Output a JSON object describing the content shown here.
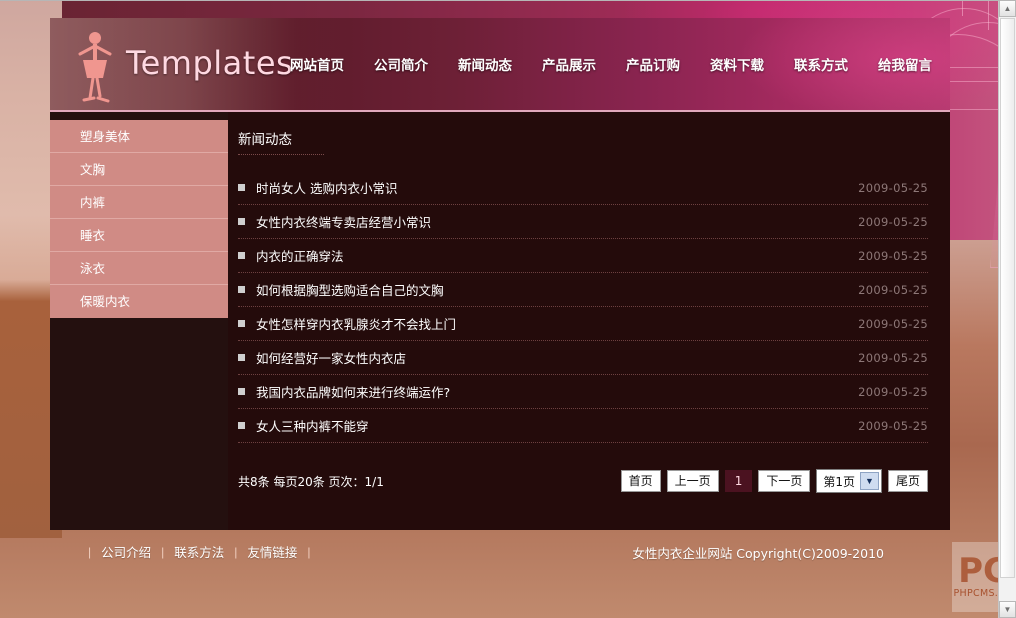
{
  "site": {
    "logo_text": "Templates",
    "logo_icon": "woman-figure-logo"
  },
  "nav": {
    "items": [
      {
        "label": "网站首页"
      },
      {
        "label": "公司简介"
      },
      {
        "label": "新闻动态"
      },
      {
        "label": "产品展示"
      },
      {
        "label": "产品订购"
      },
      {
        "label": "资料下载"
      },
      {
        "label": "联系方式"
      },
      {
        "label": "给我留言"
      }
    ]
  },
  "sidebar": {
    "items": [
      {
        "label": "塑身美体"
      },
      {
        "label": "文胸"
      },
      {
        "label": "内裤"
      },
      {
        "label": "睡衣"
      },
      {
        "label": "泳衣"
      },
      {
        "label": "保暖内衣"
      }
    ]
  },
  "content": {
    "page_title": "新闻动态",
    "news": [
      {
        "title": "时尚女人 选购内衣小常识",
        "date": "2009-05-25"
      },
      {
        "title": "女性内衣终端专卖店经营小常识",
        "date": "2009-05-25"
      },
      {
        "title": "内衣的正确穿法",
        "date": "2009-05-25"
      },
      {
        "title": "如何根据胸型选购适合自己的文胸",
        "date": "2009-05-25"
      },
      {
        "title": "女性怎样穿内衣乳腺炎才不会找上门",
        "date": "2009-05-25"
      },
      {
        "title": "如何经营好一家女性内衣店",
        "date": "2009-05-25"
      },
      {
        "title": "我国内衣品牌如何来进行终端运作?",
        "date": "2009-05-25"
      },
      {
        "title": "女人三种内裤不能穿",
        "date": "2009-05-25"
      }
    ]
  },
  "pager": {
    "info": "共8条 每页20条 页次：1/1",
    "first_label": "首页",
    "prev_label": "上一页",
    "current_page": "1",
    "next_label": "下一页",
    "select_label": "第1页",
    "select_arrow": "▼",
    "last_label": "尾页"
  },
  "footer": {
    "links": [
      {
        "label": "公司介绍"
      },
      {
        "label": "联系方法"
      },
      {
        "label": "友情链接"
      }
    ],
    "separator": "|",
    "copyright": "女性内衣企业网站 Copyright(C)2009-2010"
  },
  "watermark": {
    "mark": "PC",
    "text": "PHPCMS.CN"
  },
  "scrollbar": {
    "up_arrow": "▲",
    "down_arrow": "▼"
  },
  "colors": {
    "header_dark": "#4a1520",
    "header_bright": "#b33a6e",
    "sidebar_bg": "#d08b85",
    "content_bg": "#240b0b",
    "accent_pink": "#ffd9e2",
    "date_text": "#8d7777",
    "current_page_bg": "#4b1220"
  }
}
